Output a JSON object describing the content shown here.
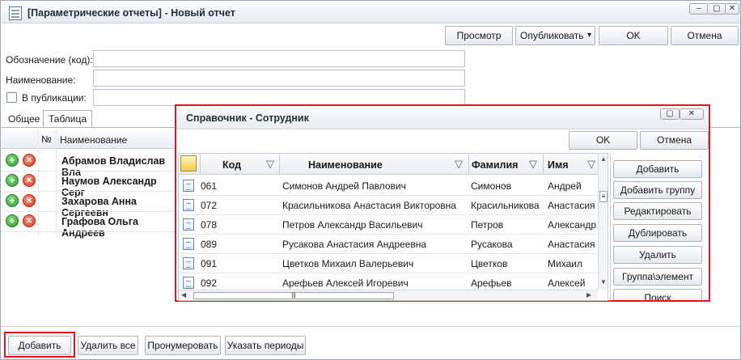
{
  "window": {
    "title": "[Параметрические отчеты] - Новый отчет",
    "minimize": "–",
    "maximize": "▢",
    "close": "✕"
  },
  "toolbar": {
    "preview": "Просмотр",
    "publish": "Опубликовать",
    "publish_arrow": "▾",
    "ok": "OK",
    "cancel": "Отмена"
  },
  "form": {
    "code_label": "Обозначение (код):",
    "code_value": "",
    "name_label": "Наименование:",
    "name_value": "",
    "publish_label": "В публикации:",
    "publish_value": ""
  },
  "tabs": [
    "Общее",
    "Таблица"
  ],
  "main_grid": {
    "col_num": "№",
    "col_name": "Наименование",
    "rows": [
      "Абрамов Владислав Вла",
      "Наумов Александр Серг",
      "Захарова Анна Сергеевн",
      "Графова Ольга Андреев"
    ]
  },
  "bottom_buttons": {
    "add": "Добавить",
    "delete_all": "Удалить все",
    "renumber": "Пронумеровать",
    "periods": "Указать периоды"
  },
  "dialog": {
    "title": "Справочник - Сотрудник",
    "ok": "OK",
    "cancel": "Отмена",
    "columns": [
      "Код",
      "Наименование",
      "Фамилия",
      "Имя"
    ],
    "rows": [
      [
        "061",
        "Симонов Андрей Павлович",
        "Симонов",
        "Андрей"
      ],
      [
        "072",
        "Красильникова Анастасия Викторовна",
        "Красильникова",
        "Анастасия"
      ],
      [
        "078",
        "Петров Александр Васильевич",
        "Петров",
        "Александр"
      ],
      [
        "089",
        "Русакова Анастасия Андреевна",
        "Русакова",
        "Анастасия"
      ],
      [
        "091",
        "Цветков Михаил Валерьевич",
        "Цветков",
        "Михаил"
      ],
      [
        "092",
        "Арефьев Алексей Игоревич",
        "Арефьев",
        "Алексей"
      ]
    ],
    "side_buttons": [
      "Добавить",
      "Добавить группу",
      "Редактировать",
      "Дублировать",
      "Удалить",
      "Группа\\элемент",
      "Поиск"
    ]
  },
  "colors": {
    "accent_red": "#e0161b",
    "border": "#a9b4c0"
  }
}
